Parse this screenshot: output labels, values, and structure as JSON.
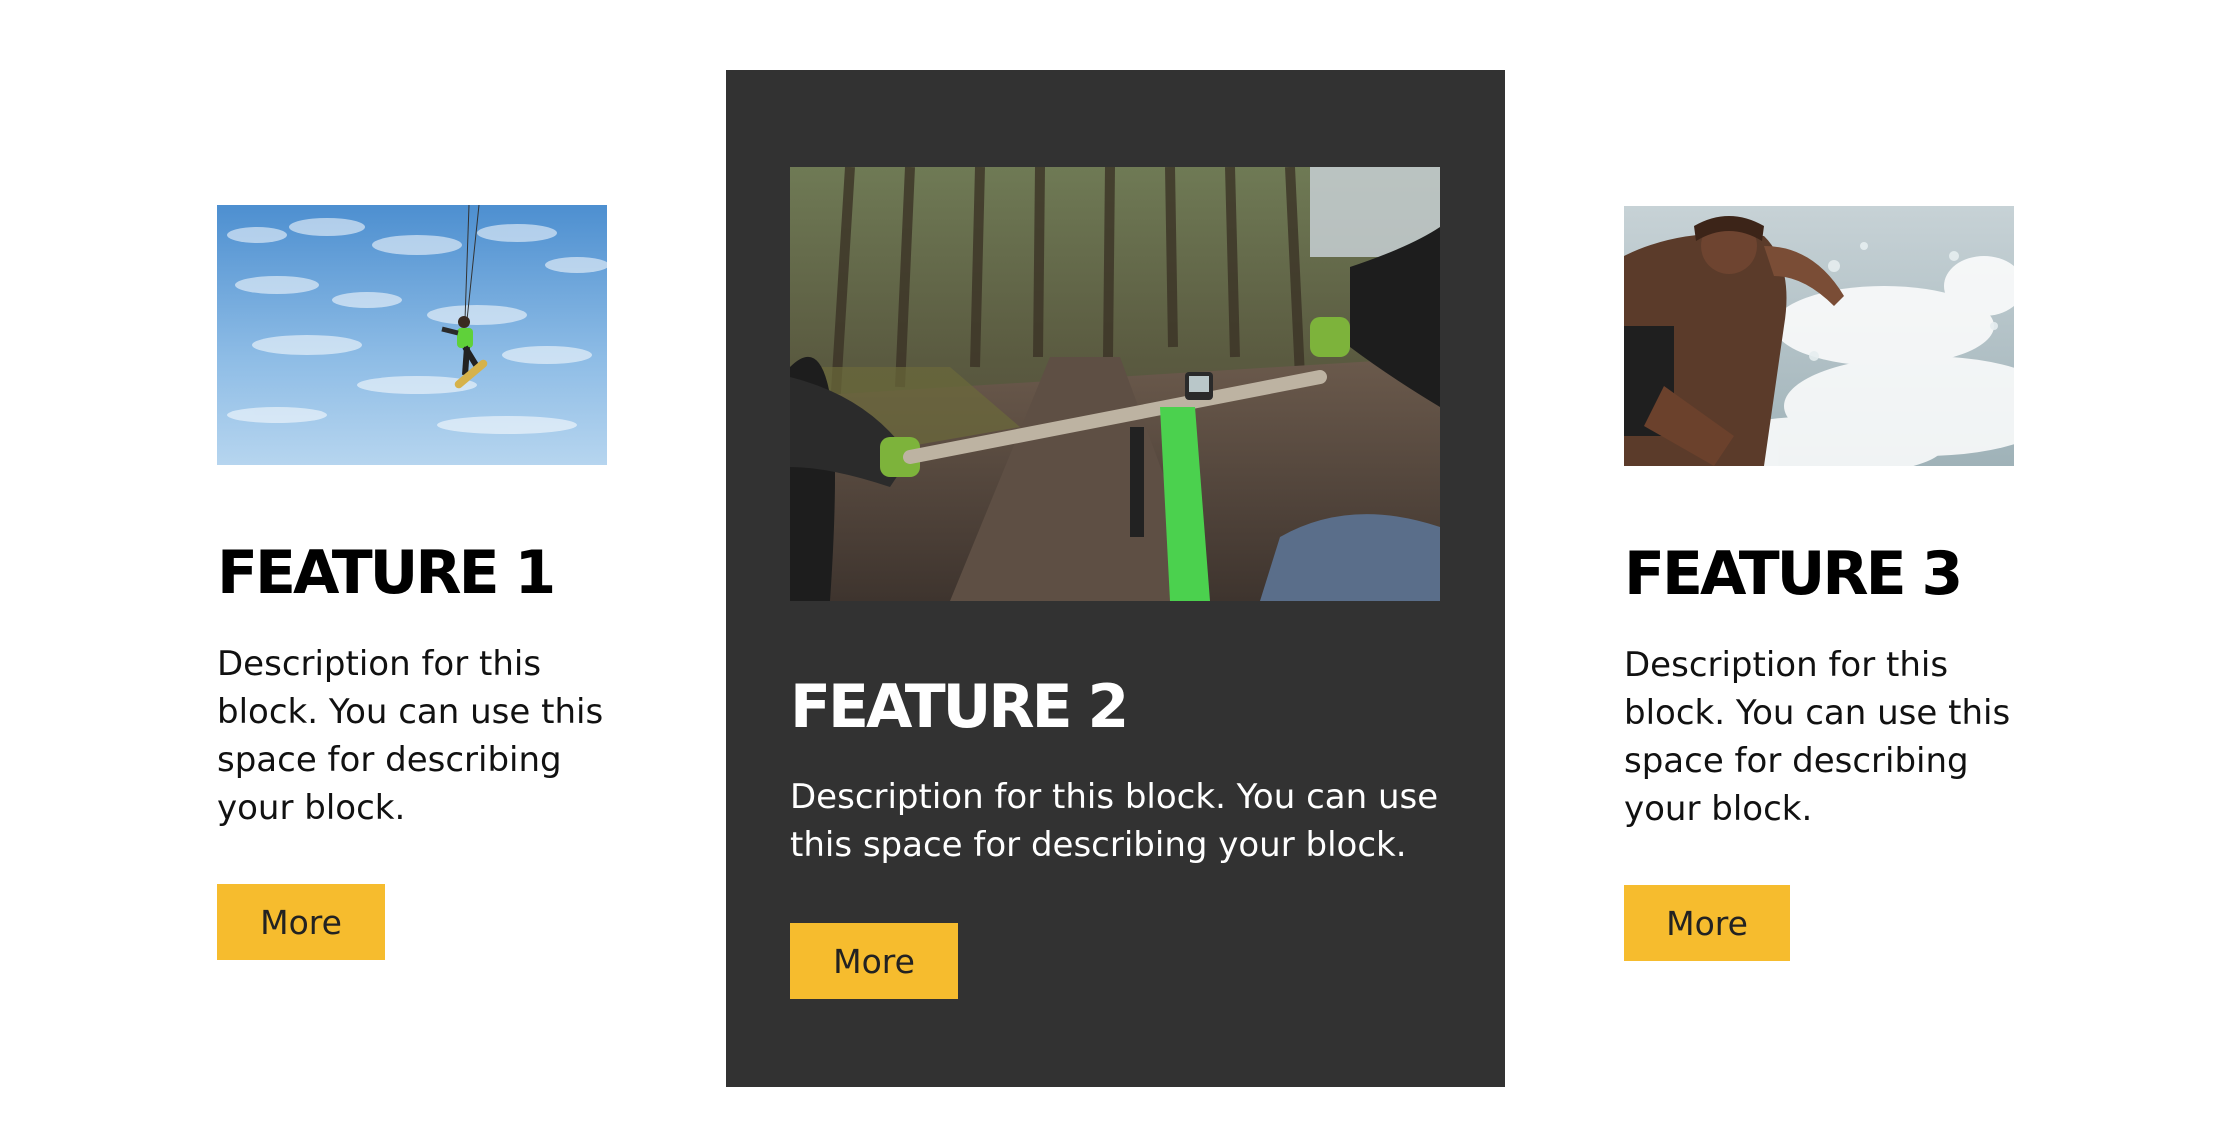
{
  "features": [
    {
      "title": "FEATURE 1",
      "description": "Description for this block. You can use this space for describing your block.",
      "button_label": "More",
      "image": "kiteboarder-in-sky-photo"
    },
    {
      "title": "FEATURE 2",
      "description": "Description for this block. You can use this space for describing your block.",
      "button_label": "More",
      "image": "mountain-bike-trail-photo"
    },
    {
      "title": "FEATURE 3",
      "description": "Description for this block. You can use this space for describing your block.",
      "button_label": "More",
      "image": "surfer-splash-photo"
    }
  ],
  "colors": {
    "accent": "#f6bc2e",
    "dark_card": "#323232",
    "background": "#ffffff"
  }
}
